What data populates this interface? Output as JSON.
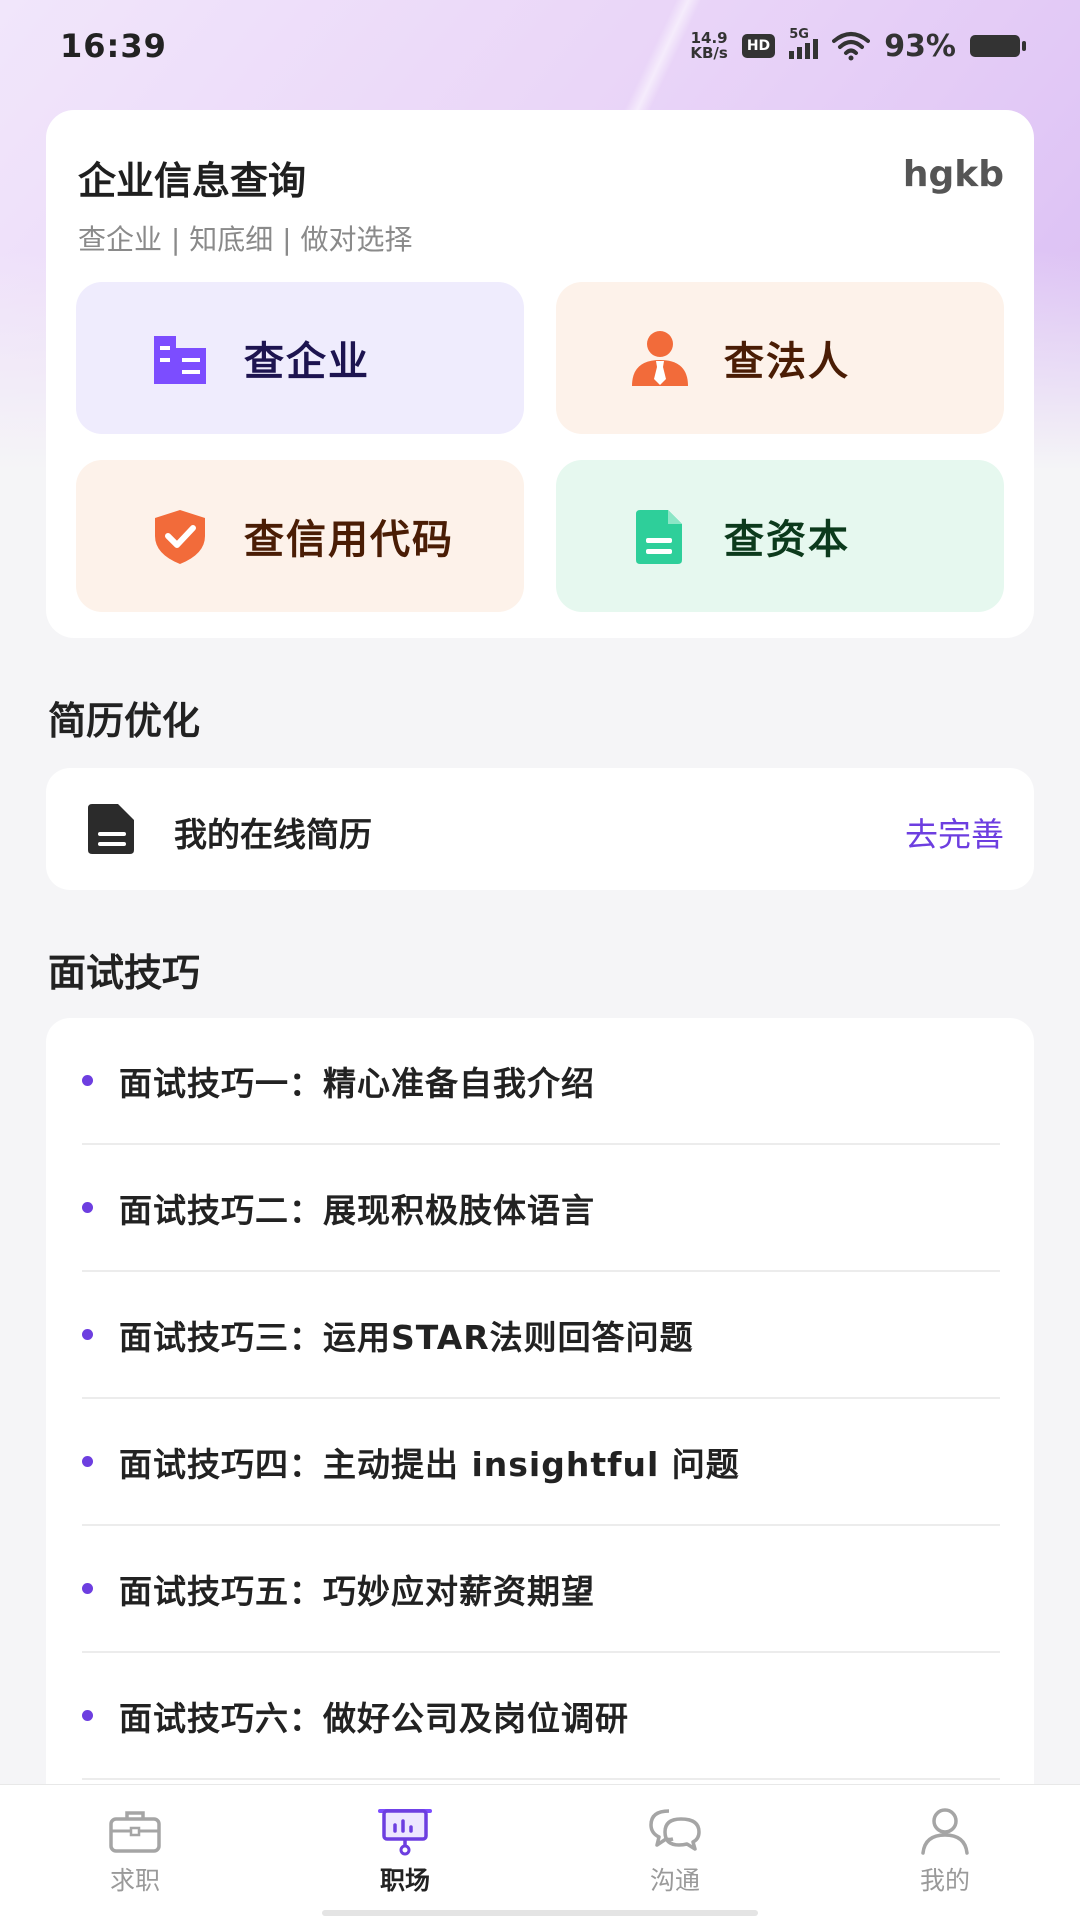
{
  "status_bar": {
    "time": "16:39",
    "net_speed_value": "14.9",
    "net_speed_unit": "KB/s",
    "hd": "HD",
    "network": "5G",
    "battery": "93%"
  },
  "enterprise": {
    "title": "企业信息查询",
    "tag": "hgkb",
    "subtitle": "查企业 | 知底细 | 做对选择",
    "buttons": [
      {
        "label": "查企业",
        "icon": "building-icon",
        "color": "#7c4dff"
      },
      {
        "label": "查法人",
        "icon": "person-tie-icon",
        "color": "#f26b3a"
      },
      {
        "label": "查信用代码",
        "icon": "shield-check-icon",
        "color": "#f26b3a"
      },
      {
        "label": "查资本",
        "icon": "document-icon",
        "color": "#2ecf9a"
      }
    ]
  },
  "resume": {
    "section_title": "简历优化",
    "label": "我的在线简历",
    "action": "去完善"
  },
  "interview": {
    "section_title": "面试技巧",
    "tips": [
      "面试技巧一：精心准备自我介绍",
      "面试技巧二：展现积极肢体语言",
      "面试技巧三：运用STAR法则回答问题",
      "面试技巧四：主动提出 insightful 问题",
      "面试技巧五：巧妙应对薪资期望",
      "面试技巧六：做好公司及岗位调研"
    ]
  },
  "bottom_nav": {
    "items": [
      {
        "label": "求职",
        "icon": "briefcase-icon",
        "active": false
      },
      {
        "label": "职场",
        "icon": "presentation-board-icon",
        "active": true
      },
      {
        "label": "沟通",
        "icon": "chat-bubbles-icon",
        "active": false
      },
      {
        "label": "我的",
        "icon": "user-icon",
        "active": false
      }
    ]
  },
  "colors": {
    "accent": "#6d3ee0",
    "background": "#f5f5f7"
  }
}
